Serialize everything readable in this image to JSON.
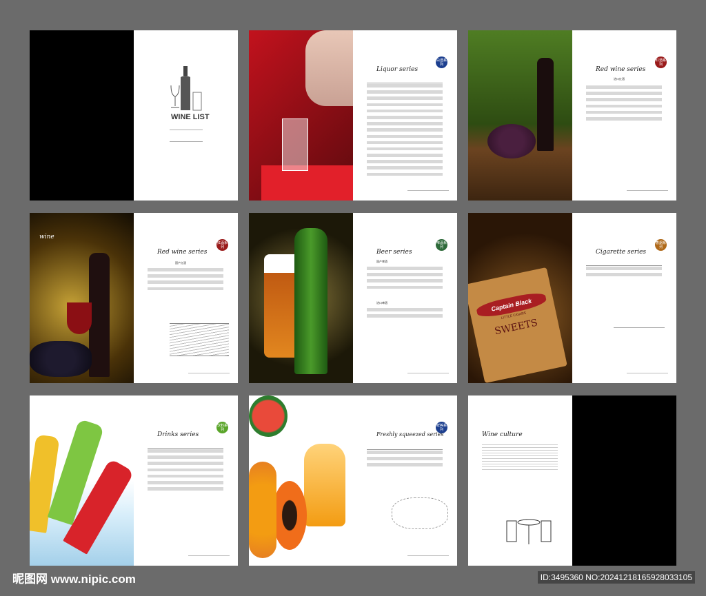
{
  "cover": {
    "title": "WINE LIST"
  },
  "spreads": [
    {
      "title": "Liquor series",
      "badge": "白酒系列",
      "badge_color": "#1c3f8f"
    },
    {
      "title": "Red wine series",
      "badge": "红酒系列",
      "badge_color": "#9a1b1b",
      "sub": "进口红酒"
    },
    {
      "title": "Red wine series",
      "badge": "红酒系列",
      "badge_color": "#9a1b1b",
      "sub": "国产红酒",
      "side_title": "wine"
    },
    {
      "title": "Beer series",
      "badge": "啤酒系列",
      "badge_color": "#2e6a3a",
      "sub": "国产啤酒",
      "sub2": "进口啤酒"
    },
    {
      "title": "Cigarette series",
      "badge": "香烟系列",
      "badge_color": "#b06a1a",
      "pack_brand": "Captain Black",
      "pack_sub": "LITTLE CIGARS",
      "pack_name": "SWEETS"
    },
    {
      "title": "Drinks series",
      "badge": "饮料系列",
      "badge_color": "#5aa52a"
    },
    {
      "title": "Freshly squeezed series",
      "badge": "鲜榨系列",
      "badge_color": "#1c3f8f"
    },
    {
      "title": "Wine culture"
    }
  ],
  "watermark": {
    "left": "昵图网 www.nipic.com",
    "right": "ID:3495360 NO:20241218165928033105"
  }
}
